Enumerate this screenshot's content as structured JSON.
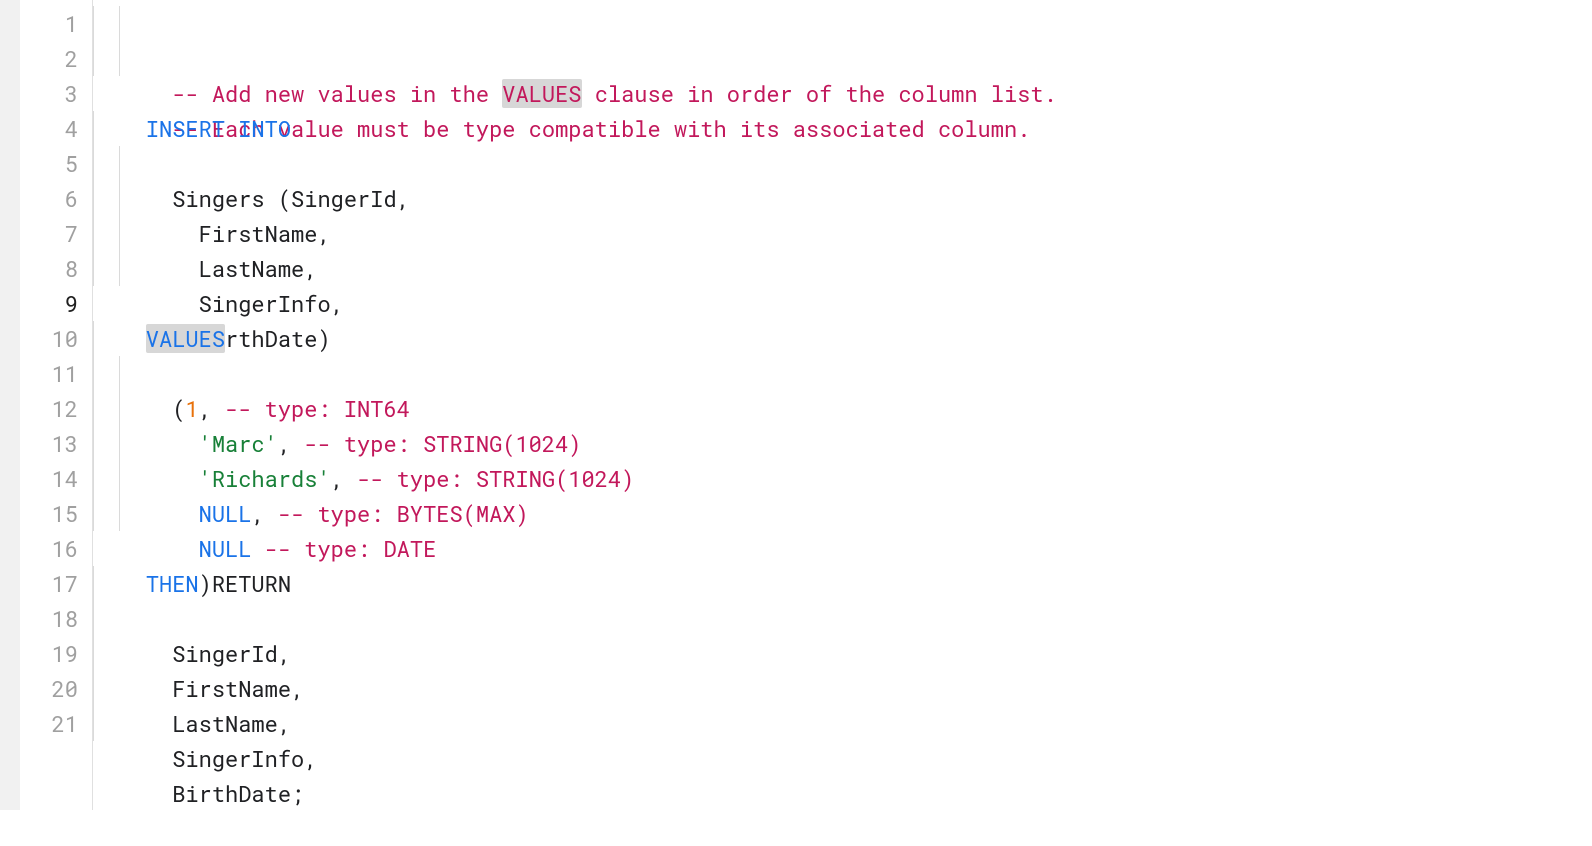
{
  "gutter": {
    "lines": [
      "1",
      "2",
      "3",
      "4",
      "5",
      "6",
      "7",
      "8",
      "9",
      "10",
      "11",
      "12",
      "13",
      "14",
      "15",
      "16",
      "17",
      "18",
      "19",
      "20",
      "21"
    ],
    "current_line": 9
  },
  "code": {
    "l1": {
      "c1": "  -- Add new values in the ",
      "hl": "VALUES",
      "c2": " clause in order of the column list."
    },
    "l2": {
      "c1": "  -- Each value must be type compatible with its associated column."
    },
    "l3": {
      "kw": "INSERT INTO"
    },
    "l4": {
      "t1": "  Singers ",
      "p1": "(",
      "t2": "SingerId",
      "p2": ","
    },
    "l5": {
      "t1": "    FirstName",
      "p1": ","
    },
    "l6": {
      "t1": "    LastName",
      "p1": ","
    },
    "l7": {
      "t1": "    SingerInfo",
      "p1": ","
    },
    "l8": {
      "t1": "    BirthDate",
      "p1": ")"
    },
    "l9": {
      "kw": "VALUES"
    },
    "l10": {
      "sp": "  ",
      "p1": "(",
      "num": "1",
      "p2": ",",
      "sp2": " ",
      "c1": "-- type: INT64"
    },
    "l11": {
      "sp": "    ",
      "str": "'Marc'",
      "p1": ",",
      "sp2": " ",
      "c1": "-- type: STRING(1024)"
    },
    "l12": {
      "sp": "    ",
      "str": "'Richards'",
      "p1": ",",
      "sp2": " ",
      "c1": "-- type: STRING(1024)"
    },
    "l13": {
      "sp": "    ",
      "nul": "NULL",
      "p1": ",",
      "sp2": " ",
      "c1": "-- type: BYTES(MAX)"
    },
    "l14": {
      "sp": "    ",
      "nul": "NULL",
      "sp2": " ",
      "c1": "-- type: DATE"
    },
    "l15": {
      "sp": "    ",
      "p1": ")"
    },
    "l16": {
      "kw": "THEN",
      "sp": " ",
      "t1": "RETURN"
    },
    "l17": {
      "t1": "  SingerId",
      "p1": ","
    },
    "l18": {
      "t1": "  FirstName",
      "p1": ","
    },
    "l19": {
      "t1": "  LastName",
      "p1": ","
    },
    "l20": {
      "t1": "  SingerInfo",
      "p1": ","
    },
    "l21": {
      "t1": "  BirthDate",
      "p1": ";"
    }
  }
}
